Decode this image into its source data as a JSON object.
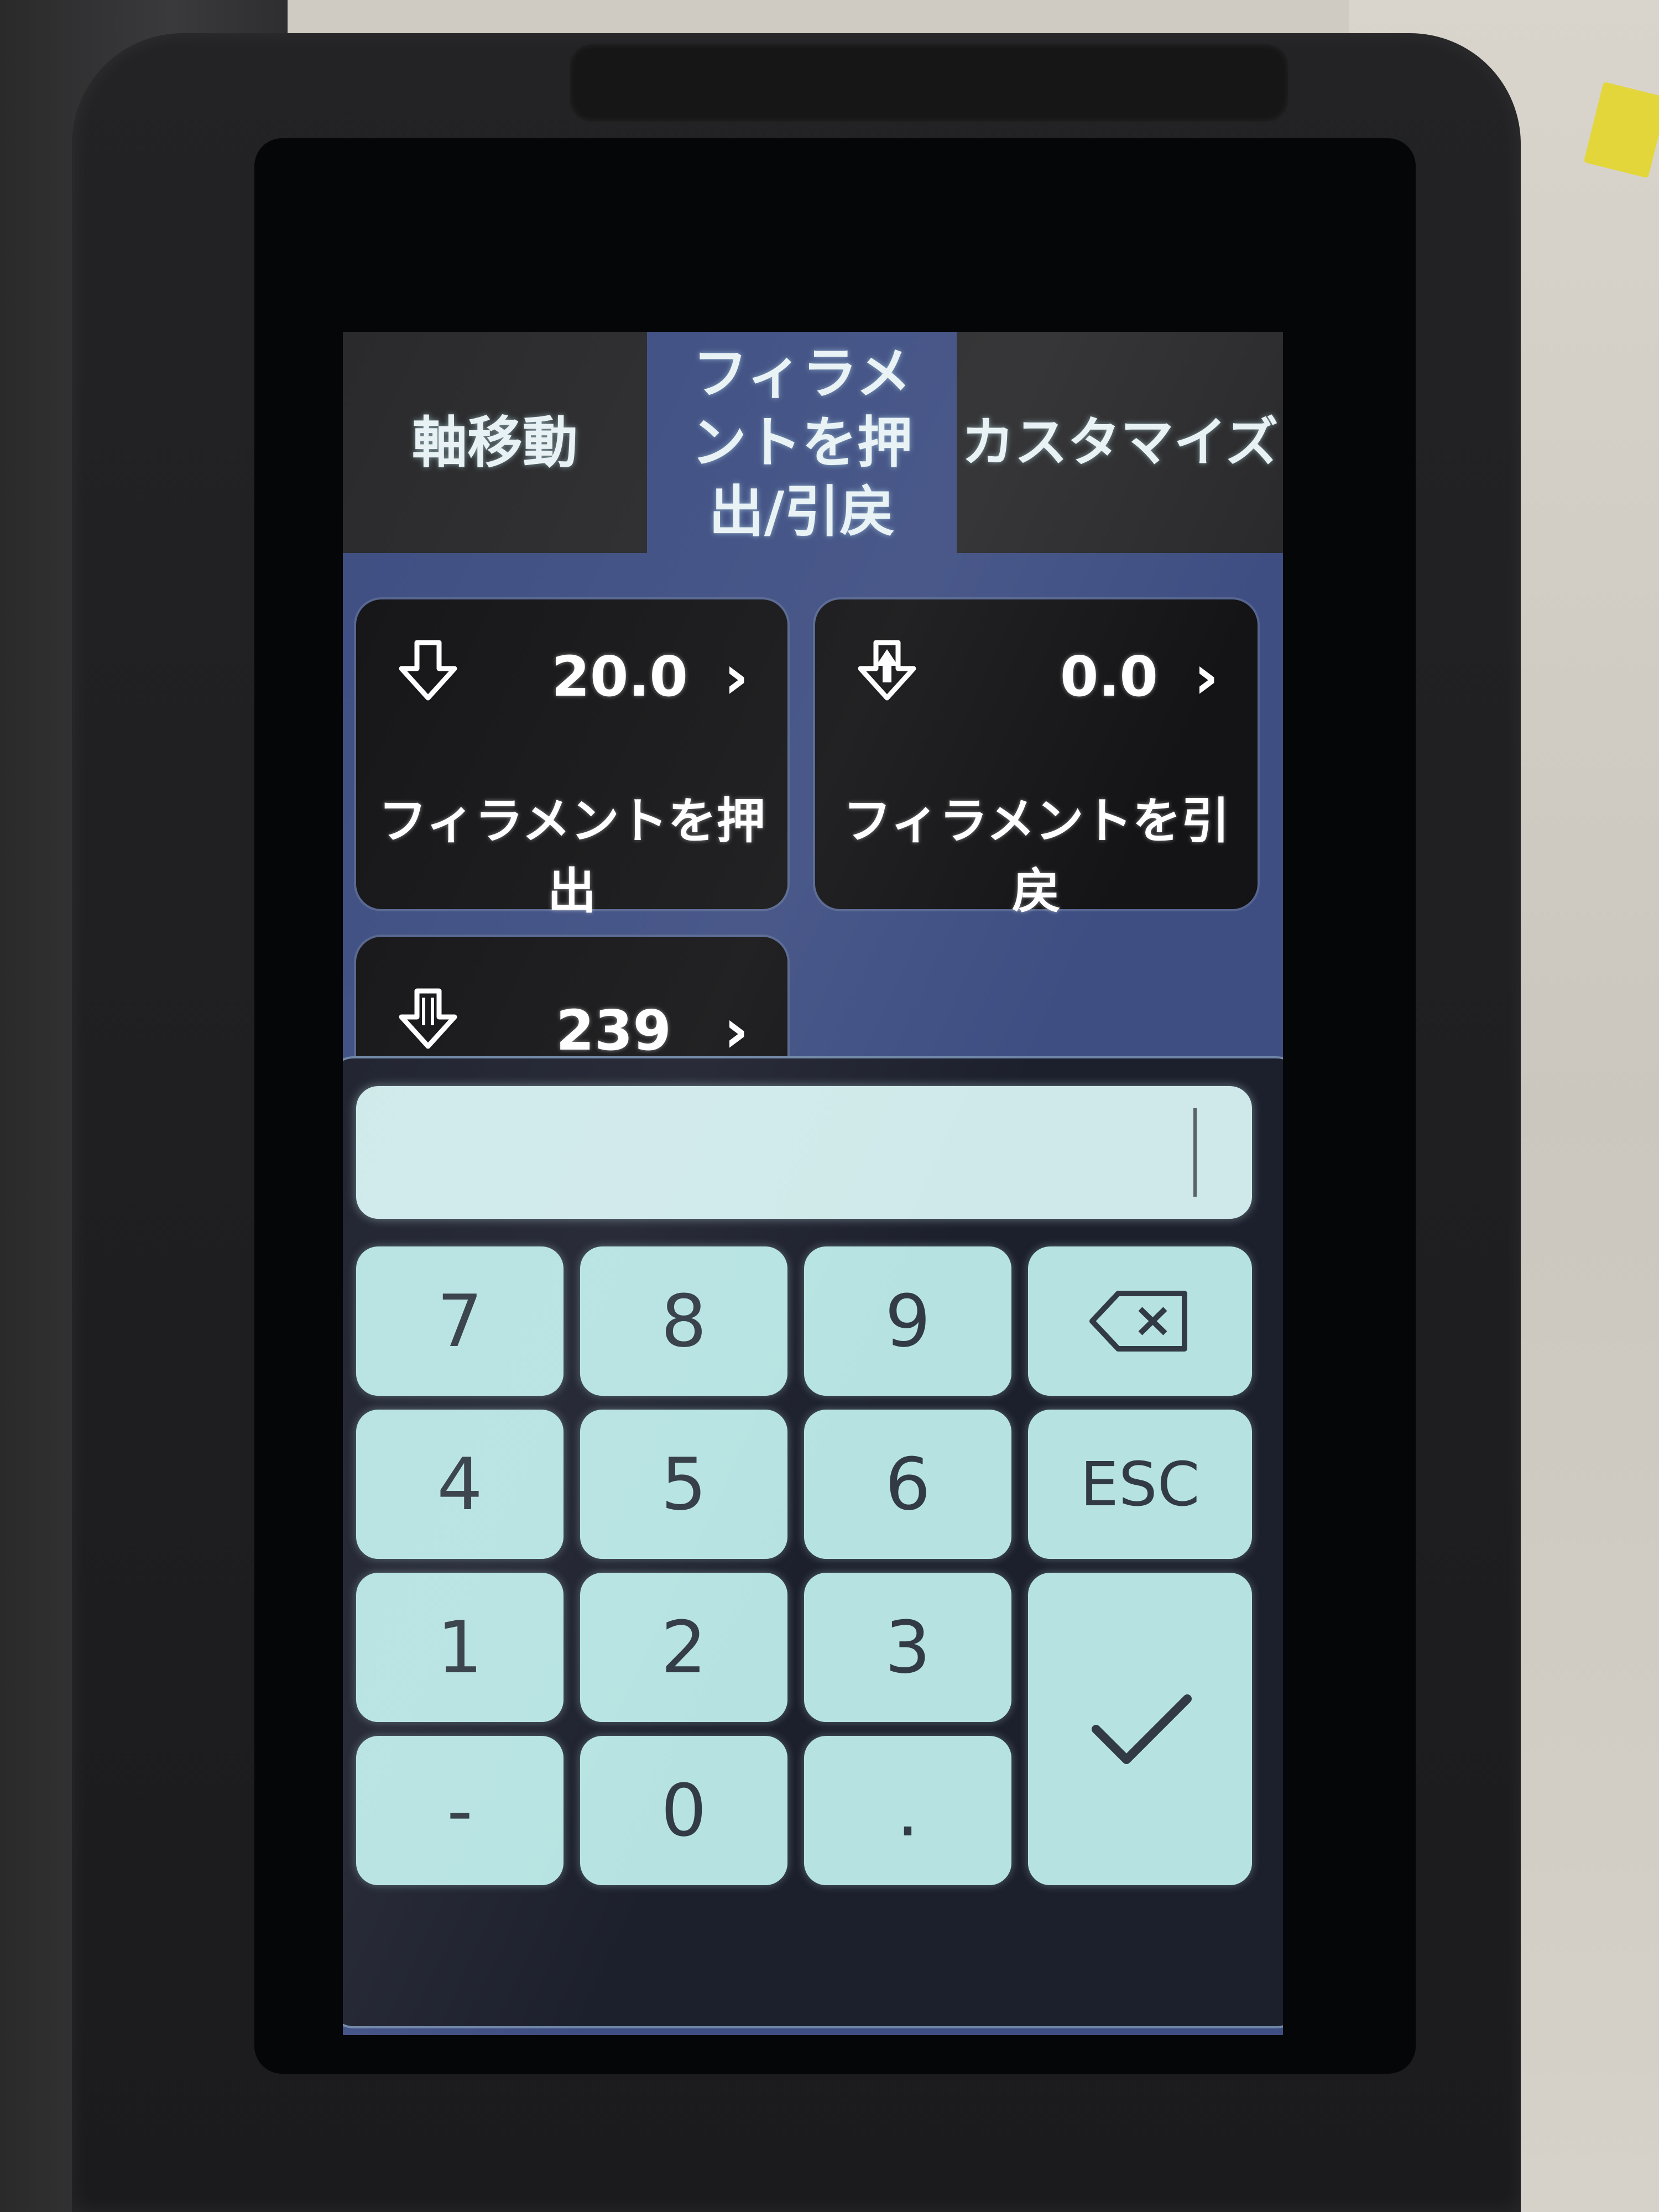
{
  "tabs": [
    {
      "label": "軸移動",
      "active": false
    },
    {
      "label": "フィラメントを押出/引戻",
      "active": true
    },
    {
      "label": "カスタマイズ",
      "active": false
    }
  ],
  "cards": [
    {
      "icon": "extrude-down-arrow-icon",
      "value": "20.0",
      "chevron": "›",
      "label": "フィラメントを押出"
    },
    {
      "icon": "retract-arrows-icon",
      "value": "0.0",
      "chevron": "›",
      "label": "フィラメントを引戻"
    },
    {
      "icon": "temperature-arrow-icon",
      "value": "239",
      "chevron": "›"
    }
  ],
  "keypad": {
    "input_value": "",
    "keys": {
      "k7": "7",
      "k8": "8",
      "k9": "9",
      "backspace": "backspace-icon",
      "k4": "4",
      "k5": "5",
      "k6": "6",
      "esc": "ESC",
      "k1": "1",
      "k2": "2",
      "k3": "3",
      "minus": "-",
      "k0": "0",
      "dot": ".",
      "confirm": "checkmark-icon"
    }
  },
  "colors": {
    "screen_bg": "#3e4e82",
    "tab_bar": "#2a2a2c",
    "card_bg": "#141416",
    "key_bg": "#b6e3e2",
    "key_text": "#323b45"
  }
}
